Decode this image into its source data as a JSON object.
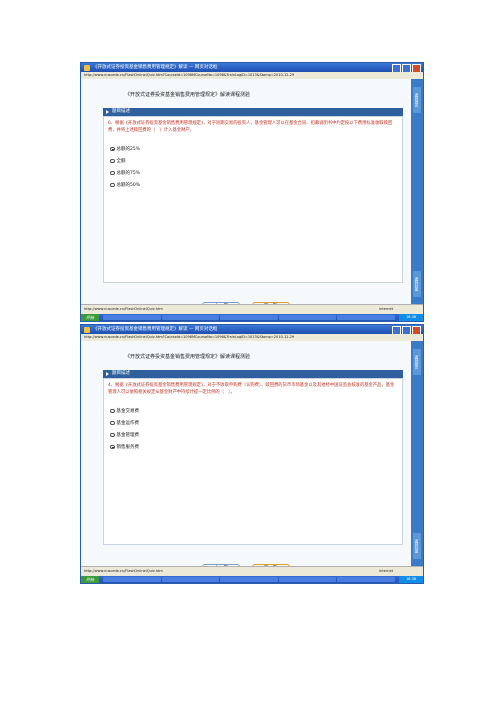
{
  "screens": [
    {
      "window_title": "《开放式证券投资基金销售费用管理规定》解读 — 网页对话框",
      "address": "http://www.nuscede.cn/FlashOnline/Quiz.htm?CourseId=1096MCourseNo=1096&TrainLogID=1013&Stamp=2010-12-29",
      "page_title": "《开放式证券投资基金销售费用管理规定》解读课程测验",
      "section_header": "题目描述",
      "question": "6、根据《开放式证券投资基金销售费用管理规定》，对于短期交易的投资人，基金管理人可以在基金合同、招募说明书中约定按以下费用标准收取赎回费，并将上述赎回费的（　）计入基金财产。",
      "options": [
        {
          "label": "总额的25%",
          "checked": true
        },
        {
          "label": "全额",
          "checked": false
        },
        {
          "label": "总额的75%",
          "checked": false
        },
        {
          "label": "总额的50%",
          "checked": false
        }
      ],
      "prev_label": "上一题",
      "next_label": "下一题",
      "side_top": "返回首页",
      "side_bottom": "返回封面",
      "status_url": "http://www.nuscede.cn/FlashOnline/Quiz.htm",
      "status_zone": "Internet",
      "start_label": "开始",
      "clock": "16:38"
    },
    {
      "window_title": "《开放式证券投资基金销售费用管理规定》解读 — 网页对话框",
      "address": "http://www.nuscede.cn/FlashOnline/Quiz.htm?CourseId=1096MCourseNo=1096&TrainLogID=1013&Stamp=2010-12-29",
      "page_title": "《开放式证券投资基金销售费用管理规定》解读课程测验",
      "section_header": "题目描述",
      "question": "4、根据《开放式证券投资基金销售费用管理规定》，对于不收取申购费（认购费）、赎回费的货币市场基金以及其他经中国证监会核准的基金产品，基金管理人可以依照相关规定从基金财产中持续计提一定比例的（　）。",
      "options": [
        {
          "label": "基金交易费",
          "checked": false
        },
        {
          "label": "基金运作费",
          "checked": false
        },
        {
          "label": "基金管理费",
          "checked": false
        },
        {
          "label": "销售服务费",
          "checked": true
        }
      ],
      "prev_label": "上一题",
      "next_label": "下一题",
      "side_top": "返回首页",
      "side_bottom": "返回封面",
      "status_url": "http://www.nuscede.cn/FlashOnline/Quiz.htm",
      "status_zone": "Internet",
      "start_label": "开始",
      "clock": "16:38"
    }
  ]
}
